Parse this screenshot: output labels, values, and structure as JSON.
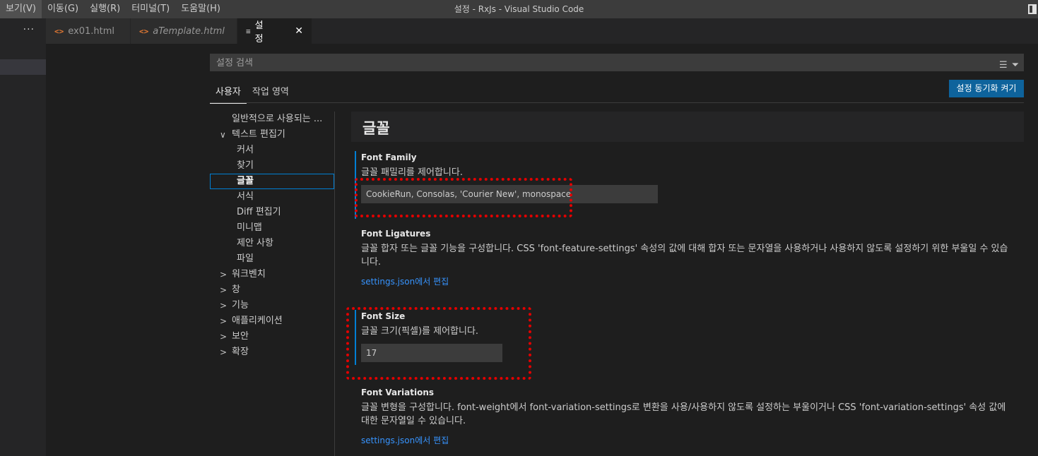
{
  "menu": [
    "보기(V)",
    "이동(G)",
    "실행(R)",
    "터미널(T)",
    "도움말(H)"
  ],
  "window_title": "설정 - RxJs - Visual Studio Code",
  "sidebar": {
    "more_label": "···"
  },
  "tabs": [
    {
      "icon": "<>",
      "label": "ex01.html"
    },
    {
      "icon": "<>",
      "label": "aTemplate.html"
    },
    {
      "icon": "≡",
      "label": "설정",
      "close": "✕"
    }
  ],
  "search": {
    "placeholder": "설정 검색"
  },
  "scope_tabs": [
    "사용자",
    "작업 영역"
  ],
  "sync_button": "설정 동기화 켜기",
  "toc": [
    {
      "label": "일반적으로 사용되는 ...",
      "chevron": ""
    },
    {
      "label": "텍스트 편집기",
      "chevron": "∨"
    },
    {
      "label": "커서",
      "chevron": ""
    },
    {
      "label": "찾기",
      "chevron": ""
    },
    {
      "label": "글꼴",
      "chevron": ""
    },
    {
      "label": "서식",
      "chevron": ""
    },
    {
      "label": "Diff 편집기",
      "chevron": ""
    },
    {
      "label": "미니맵",
      "chevron": ""
    },
    {
      "label": "제안 사항",
      "chevron": ""
    },
    {
      "label": "파일",
      "chevron": ""
    },
    {
      "label": "워크벤치",
      "chevron": ">"
    },
    {
      "label": "창",
      "chevron": ">"
    },
    {
      "label": "기능",
      "chevron": ">"
    },
    {
      "label": "애플리케이션",
      "chevron": ">"
    },
    {
      "label": "보안",
      "chevron": ">"
    },
    {
      "label": "확장",
      "chevron": ">"
    }
  ],
  "section_title": "글꼴",
  "settings": {
    "font_family": {
      "title": "Font Family",
      "desc": "글꼴 패밀리를 제어합니다.",
      "value": "CookieRun, Consolas, 'Courier New', monospace"
    },
    "font_ligatures": {
      "title": "Font Ligatures",
      "desc": "글꼴 합자 또는 글꼴 기능을 구성합니다. CSS 'font-feature-settings' 속성의 값에 대해 합자 또는 문자열을 사용하거나 사용하지 않도록 설정하기 위한 부울일 수 있습니다.",
      "link": "settings.json에서 편집"
    },
    "font_size": {
      "title": "Font Size",
      "desc": "글꼴 크기(픽셀)를 제어합니다.",
      "value": "17"
    },
    "font_variations": {
      "title": "Font Variations",
      "desc": "글꼴 변형을 구성합니다. font-weight에서 font-variation-settings로 변환을 사용/사용하지 않도록 설정하는 부울이거나 CSS 'font-variation-settings' 속성 값에 대한 문자열일 수 있습니다.",
      "link": "settings.json에서 편집"
    }
  },
  "colors": {
    "accent": "#007fd4",
    "button": "#0e639c",
    "highlight": "#e30000",
    "link": "#3794ff"
  }
}
